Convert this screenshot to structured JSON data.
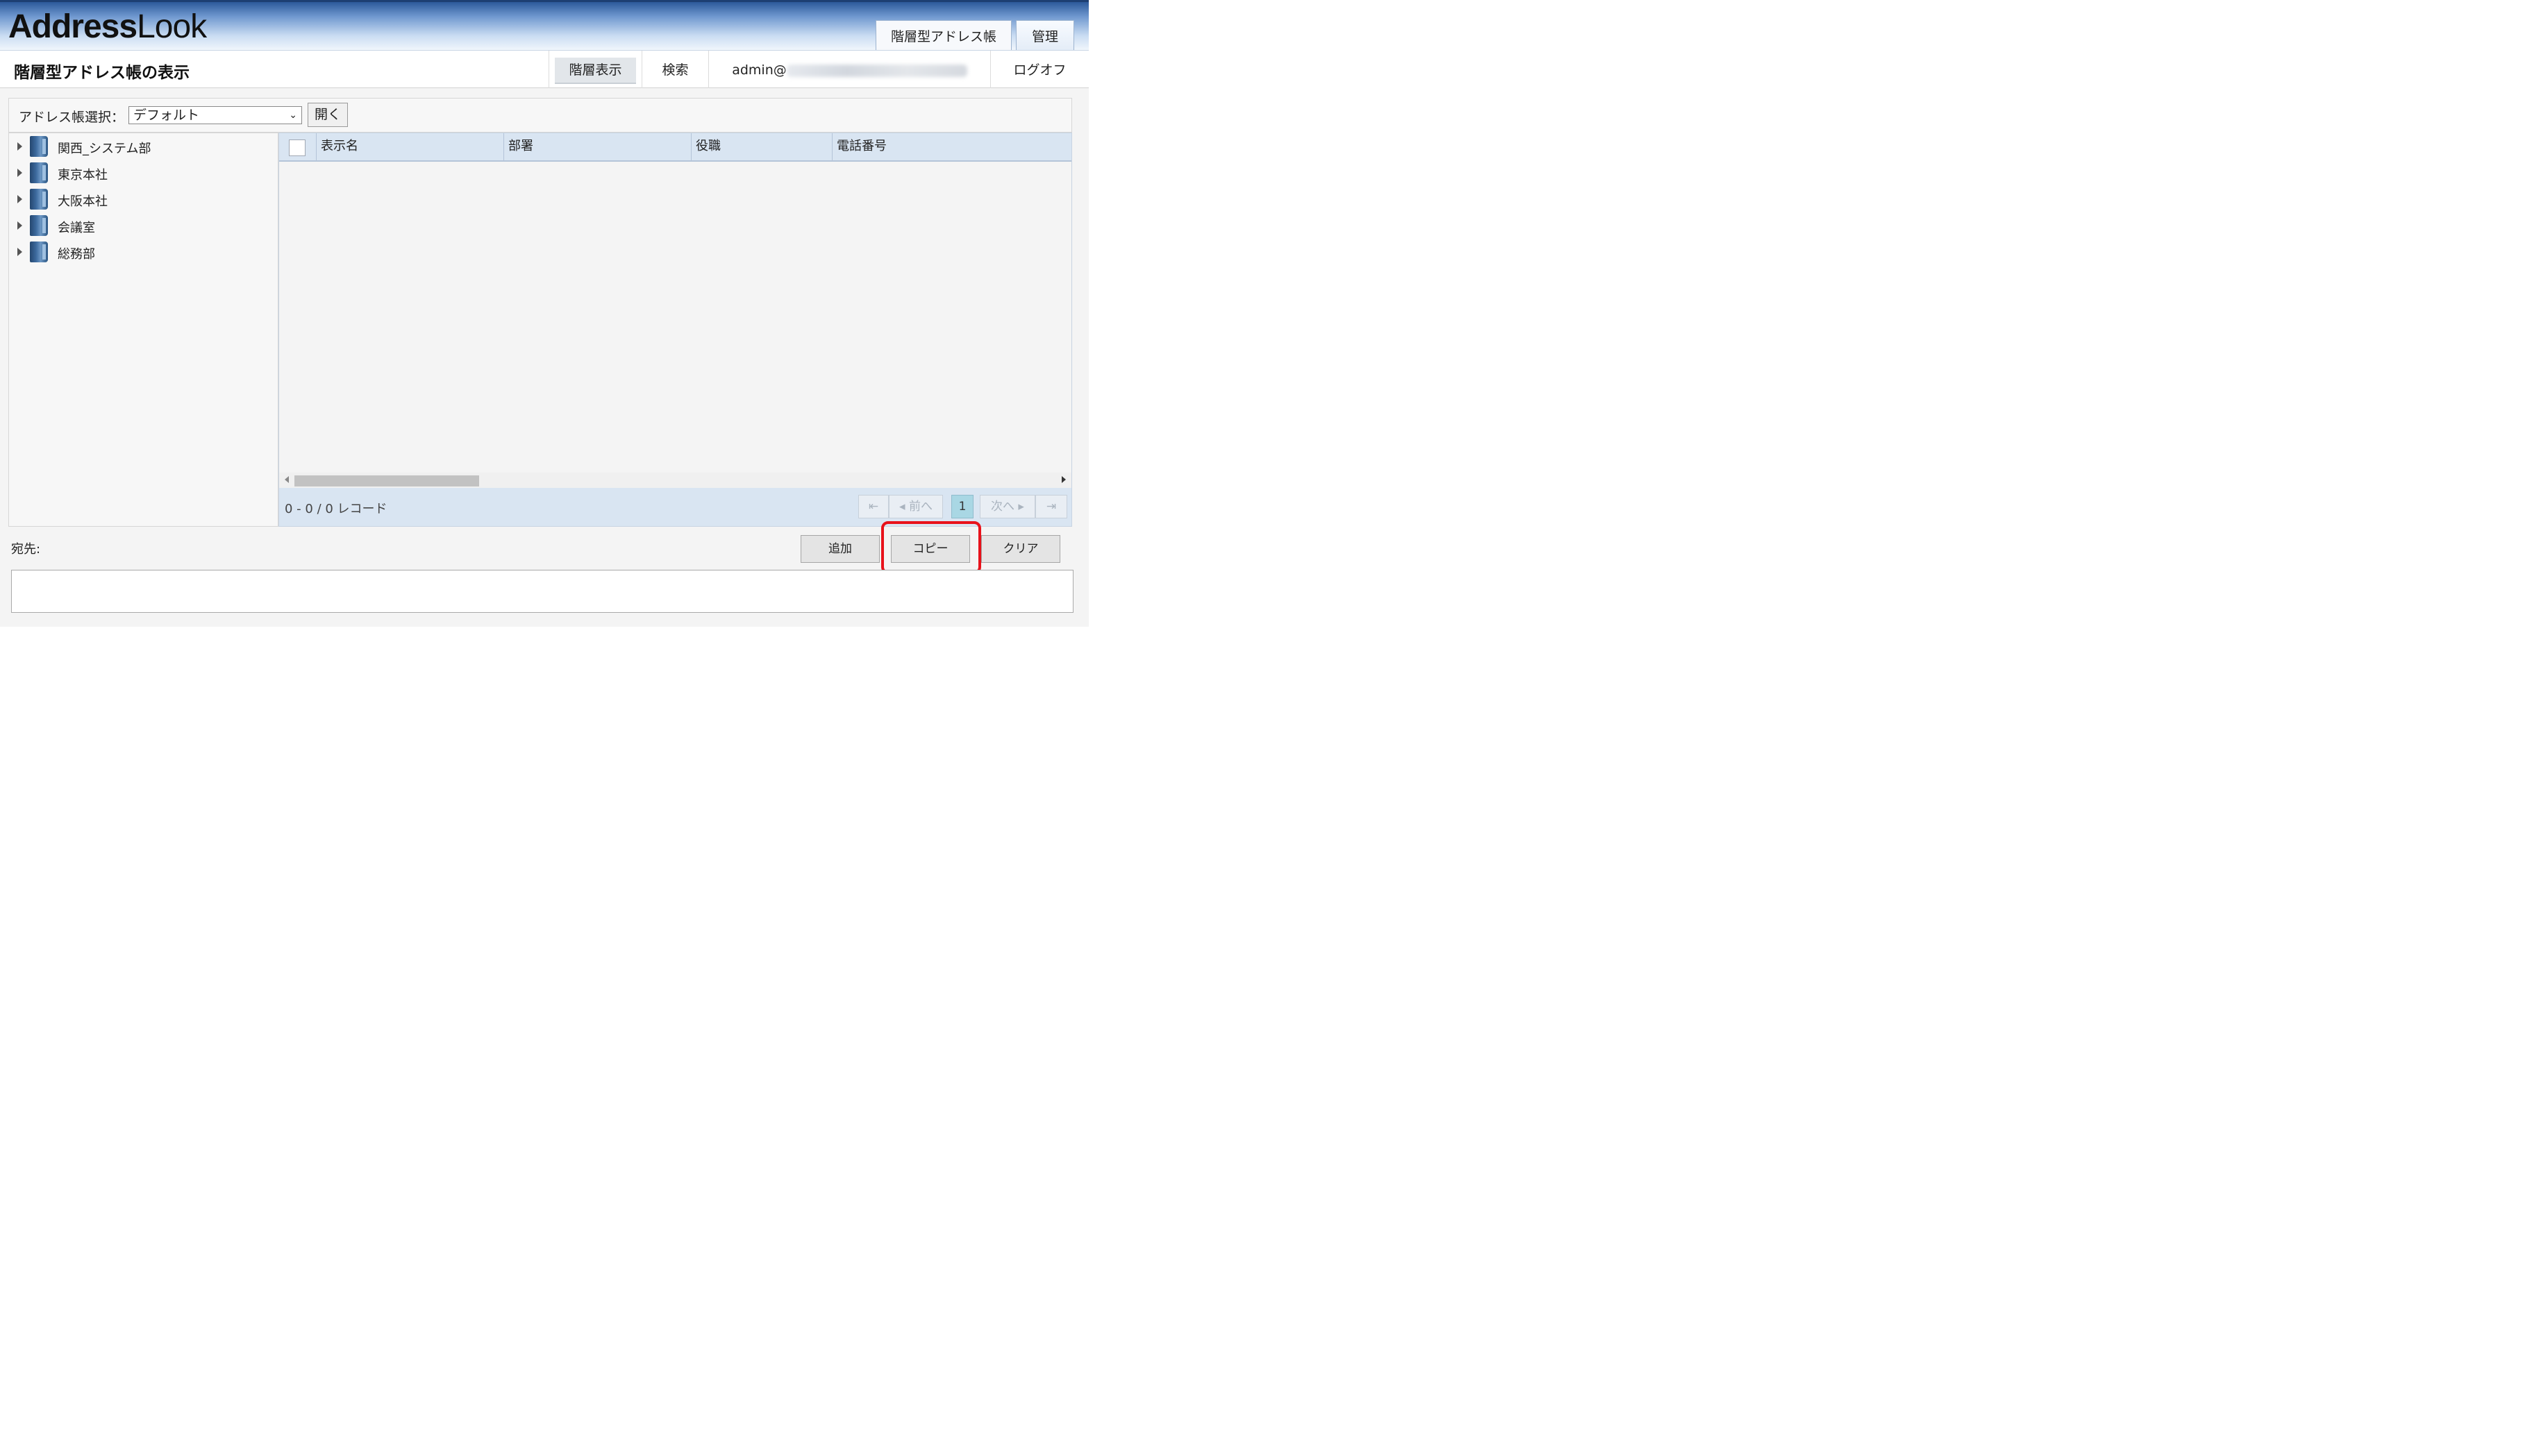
{
  "app": {
    "logo_bold": "Address",
    "logo_light": "Look",
    "top_tabs": [
      {
        "label": "階層型アドレス帳",
        "active": true
      },
      {
        "label": "管理",
        "active": false
      }
    ]
  },
  "titlebar": {
    "page_title": "階層型アドレス帳の表示",
    "nav": [
      {
        "label": "階層表示",
        "selected": true
      },
      {
        "label": "検索",
        "selected": false
      }
    ],
    "user_prefix": "admin@",
    "logout": "ログオフ"
  },
  "selector": {
    "label": "アドレス帳選択：",
    "value": "デフォルト",
    "open_button": "開く"
  },
  "tree": [
    {
      "label": "関西_システム部"
    },
    {
      "label": "東京本社"
    },
    {
      "label": "大阪本社"
    },
    {
      "label": "会議室"
    },
    {
      "label": "総務部"
    }
  ],
  "grid": {
    "columns": [
      "表示名",
      "部署",
      "役職",
      "電話番号"
    ],
    "rows": [],
    "record_info": "0 - 0 / 0 レコード",
    "pager": {
      "first": "⇤",
      "prev": "◂ 前へ",
      "page": "1",
      "next": "次へ ▸",
      "last": "⇥"
    }
  },
  "destination": {
    "label": "宛先:",
    "value": ""
  },
  "actions": {
    "add": "追加",
    "copy": "コピー",
    "clear": "クリア"
  },
  "colors": {
    "header_blue": "#2c5a9a",
    "grid_header": "#d9e5f2",
    "highlight_red": "#e8121b",
    "current_page": "#a9d7e4"
  }
}
